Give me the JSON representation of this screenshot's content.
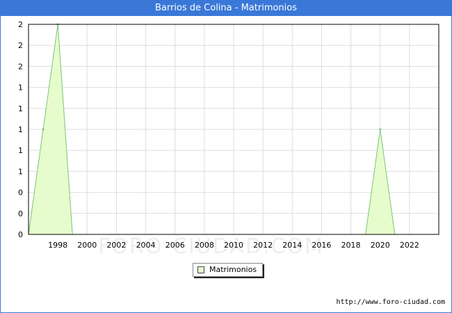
{
  "title": "Barrios de Colina - Matrimonios",
  "watermark": "FORO-CIUDAD.COM",
  "source": "http://www.foro-ciudad.com",
  "colors": {
    "title_bg": "#3a78d8",
    "area_fill": "#e6fccc",
    "area_stroke": "#7cc47c",
    "grid": "#dddddd"
  },
  "chart_data": {
    "type": "area",
    "title": "Barrios de Colina - Matrimonios",
    "xlabel": "",
    "ylabel": "",
    "x": [
      1996,
      1997,
      1998,
      1999,
      2000,
      2001,
      2002,
      2003,
      2004,
      2005,
      2006,
      2007,
      2008,
      2009,
      2010,
      2011,
      2012,
      2013,
      2014,
      2015,
      2016,
      2017,
      2018,
      2019,
      2020,
      2021,
      2022
    ],
    "series": [
      {
        "name": "Matrimonios",
        "values": [
          0,
          1,
          2,
          0,
          0,
          0,
          0,
          0,
          0,
          0,
          0,
          0,
          0,
          0,
          0,
          0,
          0,
          0,
          0,
          0,
          0,
          0,
          0,
          0,
          1,
          0,
          0
        ]
      }
    ],
    "xlim": [
      1996,
      2024
    ],
    "ylim": [
      0,
      2
    ],
    "x_ticks": [
      "1998",
      "2000",
      "2002",
      "2004",
      "2006",
      "2008",
      "2010",
      "2012",
      "2014",
      "2016",
      "2018",
      "2020",
      "2022"
    ],
    "y_ticks": [
      "0",
      "0",
      "0",
      "1",
      "1",
      "1",
      "1",
      "1",
      "2",
      "2",
      "2"
    ],
    "grid": true,
    "legend": "bottom-center"
  }
}
